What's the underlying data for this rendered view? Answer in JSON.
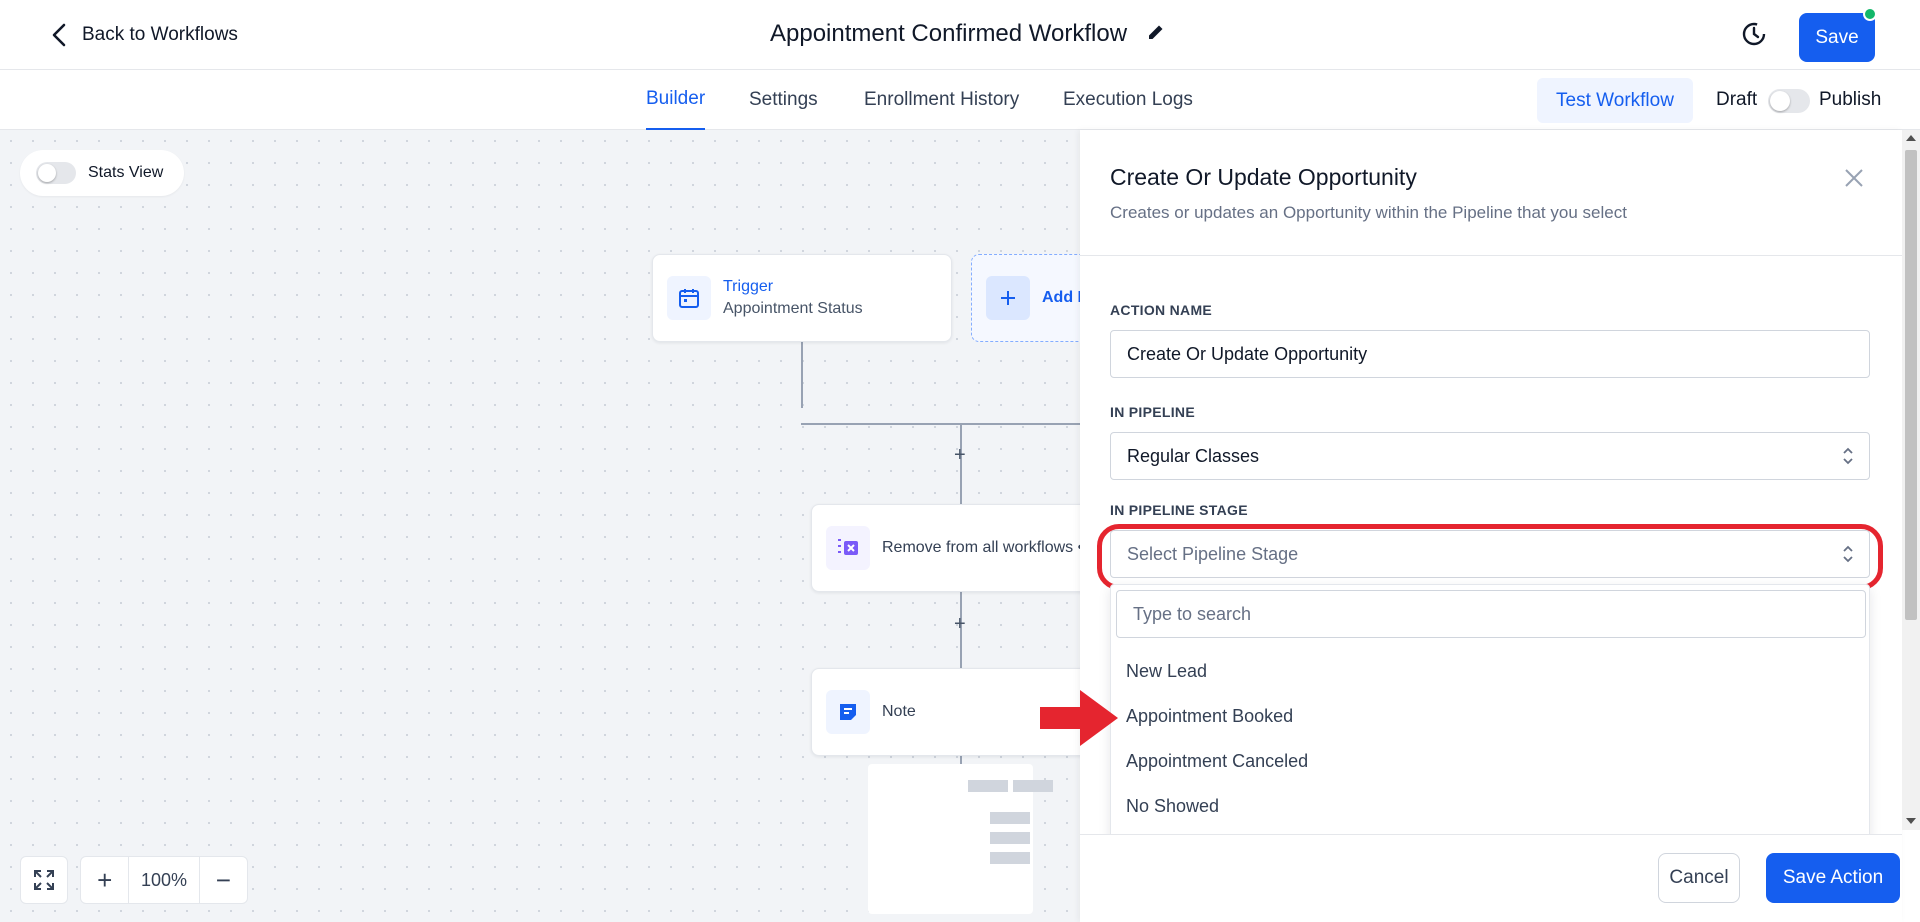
{
  "header": {
    "back_label": "Back to Workflows",
    "title": "Appointment Confirmed Workflow",
    "save_label": "Save"
  },
  "tabs": [
    {
      "label": "Builder",
      "active": true
    },
    {
      "label": "Settings",
      "active": false
    },
    {
      "label": "Enrollment History",
      "active": false
    },
    {
      "label": "Execution Logs",
      "active": false
    }
  ],
  "toolbar": {
    "test_label": "Test Workflow",
    "draft_label": "Draft",
    "publish_label": "Publish"
  },
  "canvas": {
    "stats_label": "Stats View",
    "trigger": {
      "title": "Trigger",
      "subtitle": "Appointment Status"
    },
    "add_label": "Add N",
    "node_remove": "Remove from all workflows •",
    "node_note": "Note",
    "zoom": "100%",
    "plus": "+",
    "minus": "−"
  },
  "panel": {
    "title": "Create Or Update Opportunity",
    "subtitle": "Creates or updates an Opportunity within the Pipeline that you select",
    "action_name_label": "ACTION NAME",
    "action_name_value": "Create Or Update Opportunity",
    "pipeline_label": "IN PIPELINE",
    "pipeline_value": "Regular Classes",
    "stage_label": "IN PIPELINE STAGE",
    "stage_placeholder": "Select Pipeline Stage",
    "search_placeholder": "Type to search",
    "options": [
      "New Lead",
      "Appointment Booked",
      "Appointment Canceled",
      "No Showed"
    ],
    "cancel_label": "Cancel",
    "save_action_label": "Save Action"
  },
  "colors": {
    "accent": "#155eef",
    "highlight": "#e5252f",
    "online_dot": "#12b76a"
  }
}
